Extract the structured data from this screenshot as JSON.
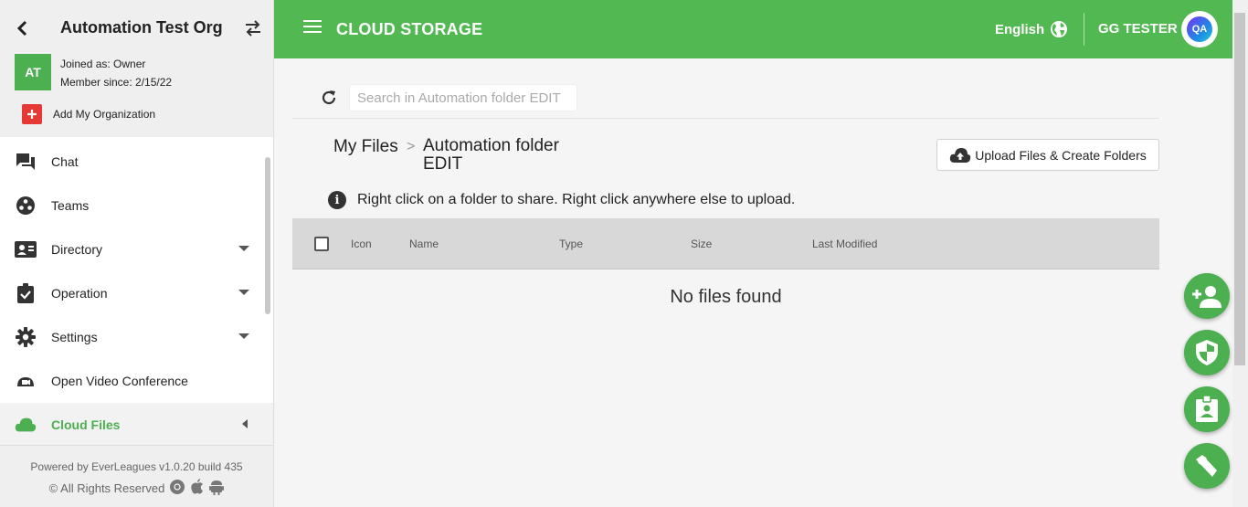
{
  "sidebar": {
    "org_name": "Automation Test Org",
    "avatar_initials": "AT",
    "joined_as": "Joined as: Owner",
    "member_since": "Member since: 2/15/22",
    "add_org_label": "Add My Organization",
    "items": [
      {
        "label": "Chat",
        "icon": "chat-icon"
      },
      {
        "label": "Teams",
        "icon": "teams-icon"
      },
      {
        "label": "Directory",
        "icon": "directory-icon"
      },
      {
        "label": "Operation",
        "icon": "operation-icon"
      },
      {
        "label": "Settings",
        "icon": "gear-icon"
      },
      {
        "label": "Open Video Conference",
        "icon": "video-icon"
      },
      {
        "label": "Cloud Files",
        "icon": "cloud-icon"
      }
    ],
    "powered_by": "Powered by EverLeagues v1.0.20 build 435",
    "rights": "© All Rights Reserved"
  },
  "header": {
    "title": "CLOUD STORAGE",
    "language": "English",
    "user": "GG TESTER",
    "user_avatar_text": "QA"
  },
  "main": {
    "search_placeholder": "Search in Automation folder EDIT",
    "breadcrumb_root": "My Files",
    "breadcrumb_sep": ">",
    "breadcrumb_current": "Automation folder EDIT",
    "upload_label": "Upload Files & Create Folders",
    "info_text": "Right click on a folder to share. Right click anywhere else to upload.",
    "columns": [
      "Icon",
      "Name",
      "Type",
      "Size",
      "Last Modified"
    ],
    "empty_text": "No files found"
  },
  "colors": {
    "brand_green": "#52b852",
    "add_org_red": "#e53935"
  }
}
